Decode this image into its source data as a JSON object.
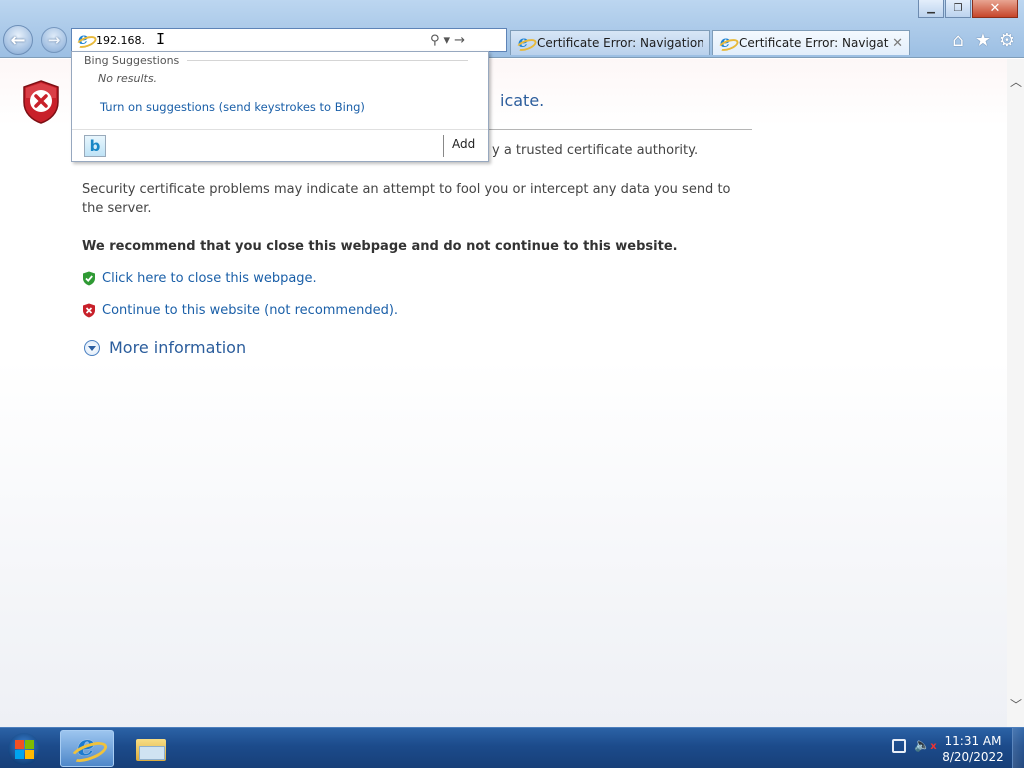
{
  "window": {
    "controls": {
      "minimize": "▁",
      "restore": "❐",
      "close": "✕"
    }
  },
  "toolbar": {
    "back_icon": "←",
    "forward_icon": "→",
    "address_value": "192.168.",
    "search_icon": "⚲",
    "dropdown_icon": "▾",
    "go_icon": "→"
  },
  "tabs": [
    {
      "title": "Certificate Error: Navigation Bl...",
      "active": false
    },
    {
      "title": "Certificate Error: Navigation...",
      "active": true,
      "close": "✕"
    }
  ],
  "tools": {
    "home": "⌂",
    "favorites": "★",
    "settings": "⚙"
  },
  "suggestions": {
    "header": "Bing Suggestions",
    "no_results": "No results.",
    "turn_on": "Turn on suggestions (send keystrokes to Bing)",
    "bing_logo": "b",
    "add_label": "Add"
  },
  "page": {
    "heading_visible": "icate.",
    "line1_visible": "y a trusted certificate authority.",
    "line2": "Security certificate problems may indicate an attempt to fool you or intercept any data you send to the server.",
    "recommend": "We recommend that you close this webpage and do not continue to this website.",
    "close_link": "Click here to close this webpage.",
    "continue_link": "Continue to this website (not recommended).",
    "more_info": "More information"
  },
  "colors": {
    "link": "#1a5fa8",
    "heading": "#2b5d9c",
    "shield_red": "#c8202a",
    "shield_green": "#2f9a34",
    "taskbar": "#1c4b8b"
  },
  "taskbar": {
    "time": "11:31 AM",
    "date": "8/20/2022",
    "volume_icon": "🔈",
    "volume_mute_mark": "x"
  },
  "scrollbar": {
    "up": "︿",
    "down": "﹀"
  }
}
